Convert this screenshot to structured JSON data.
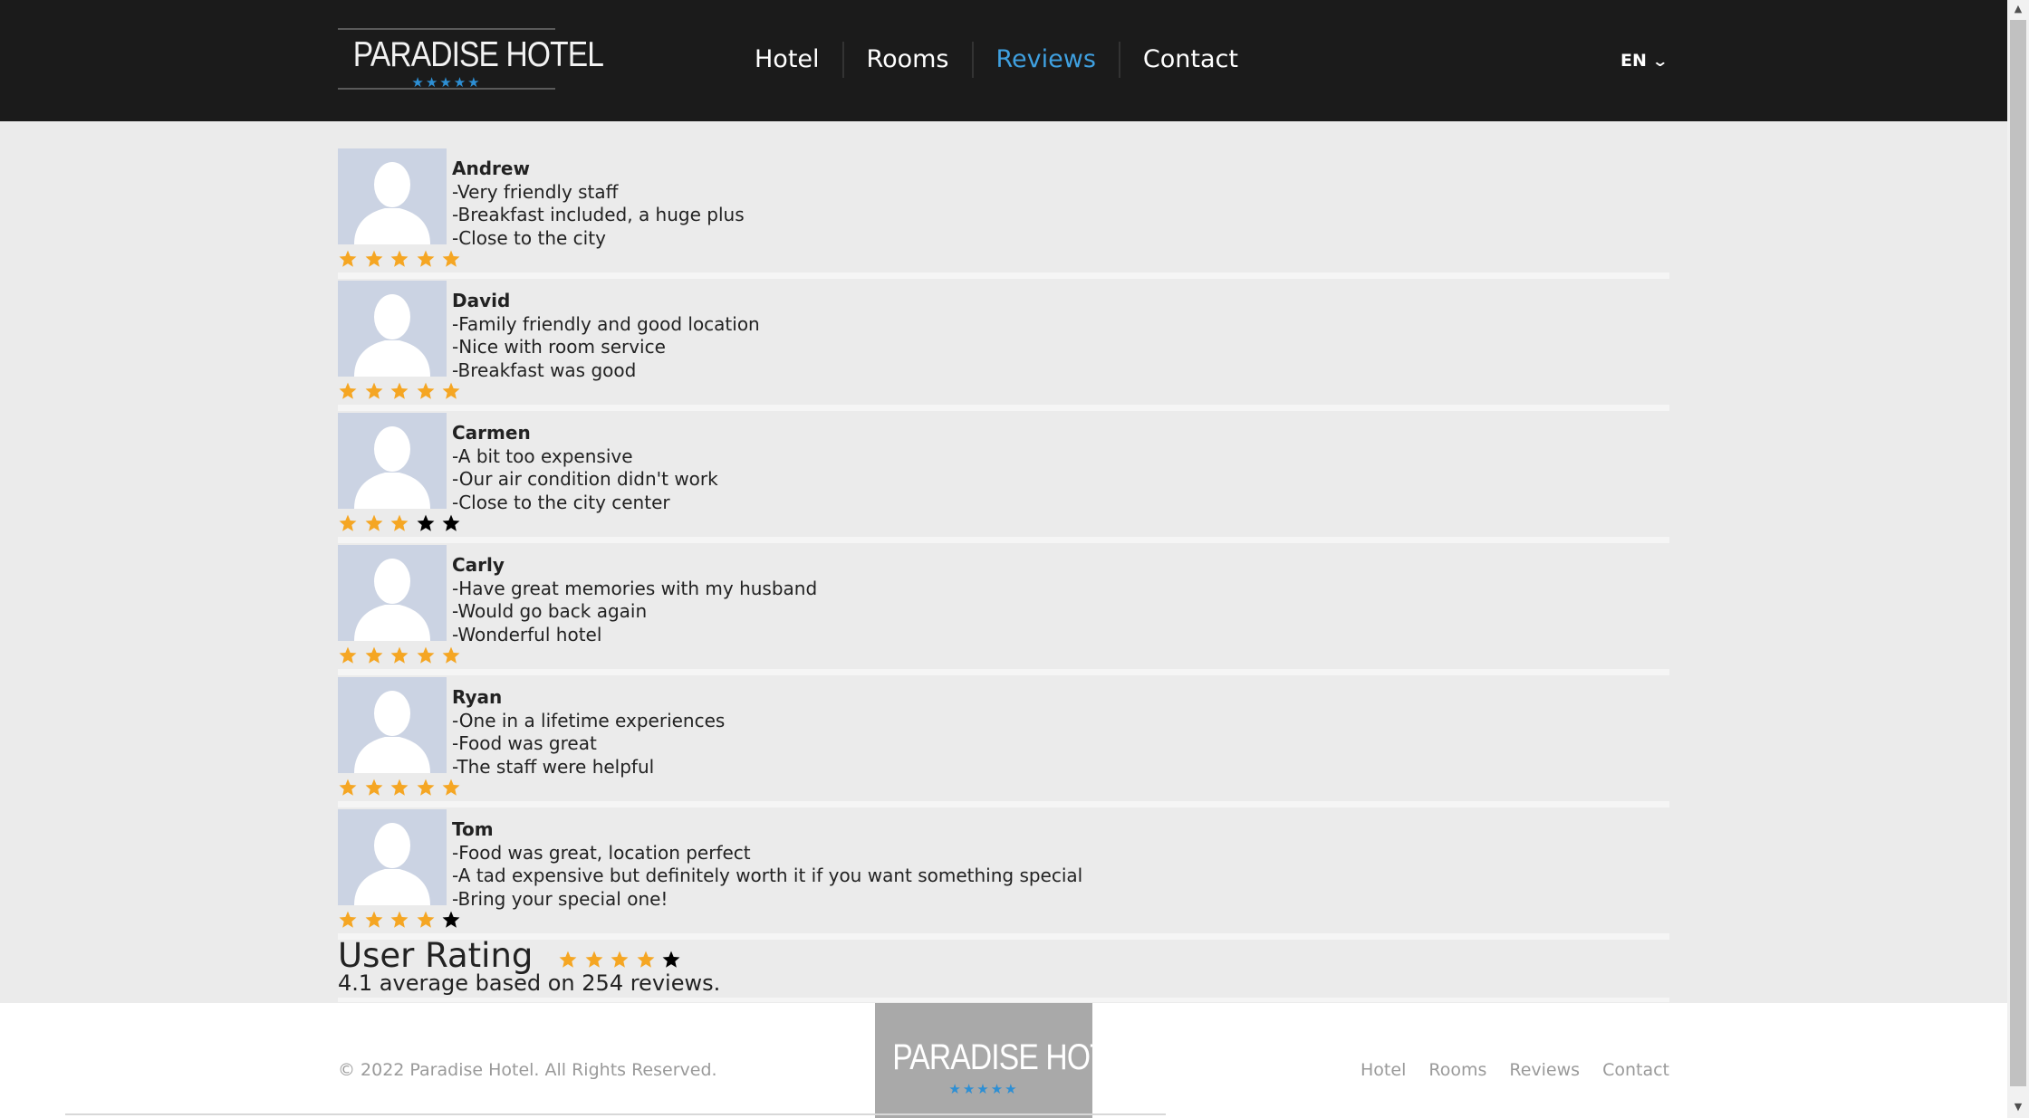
{
  "header": {
    "logo_text": "PARADISE HOTEL",
    "logo_stars": "★★★★★",
    "nav": [
      {
        "label": "Hotel",
        "active": false
      },
      {
        "label": "Rooms",
        "active": false
      },
      {
        "label": "Reviews",
        "active": true
      },
      {
        "label": "Contact",
        "active": false
      }
    ],
    "language": "EN"
  },
  "colors": {
    "header_bg": "#1b1b1b",
    "nav_active": "#3fa0e0",
    "star_filled": "#f5a623",
    "star_empty": "#000000",
    "avatar_bg": "#cbd3e3",
    "logo_stars": "#2d8fd4"
  },
  "reviews": [
    {
      "name": "Andrew",
      "lines": [
        "-Very friendly staff",
        "-Breakfast included, a huge plus",
        "-Close to the city"
      ],
      "rating": 5
    },
    {
      "name": "David",
      "lines": [
        "-Family friendly and good location",
        "-Nice with room service",
        "-Breakfast was good"
      ],
      "rating": 5
    },
    {
      "name": "Carmen",
      "lines": [
        "-A bit too expensive",
        "-Our air condition didn't work",
        "-Close to the city center"
      ],
      "rating": 3
    },
    {
      "name": "Carly",
      "lines": [
        "-Have great memories with my husband",
        "-Would go back again",
        "-Wonderful hotel"
      ],
      "rating": 5
    },
    {
      "name": "Ryan",
      "lines": [
        "-One in a lifetime experiences",
        "-Food was great",
        "-The staff were helpful"
      ],
      "rating": 5
    },
    {
      "name": "Tom",
      "lines": [
        "-Food was great, location perfect",
        "-A tad expensive but definitely worth it if you want something special",
        "-Bring your special one!"
      ],
      "rating": 4
    }
  ],
  "summary": {
    "title": "User Rating",
    "rating": 4,
    "text": "4.1 average based on 254 reviews."
  },
  "footer": {
    "copyright": "© 2022 Paradise Hotel. All Rights Reserved.",
    "logo_text": "PARADISE HOTEL",
    "logo_stars": "★★★★★",
    "nav": [
      "Hotel",
      "Rooms",
      "Reviews",
      "Contact"
    ]
  }
}
